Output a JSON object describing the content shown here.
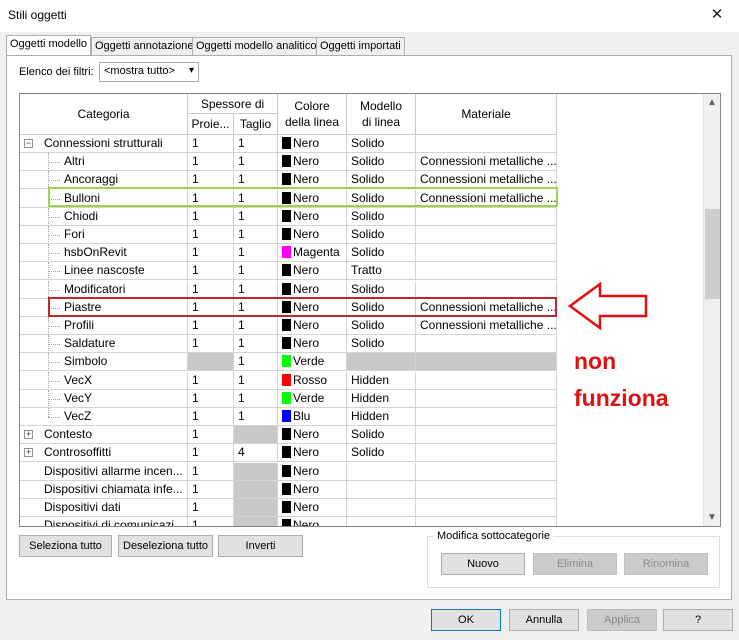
{
  "window": {
    "title": "Stili oggetti",
    "close_glyph": "✕"
  },
  "tabs": [
    "Oggetti modello",
    "Oggetti annotazione",
    "Oggetti modello analitico",
    "Oggetti importati"
  ],
  "filter": {
    "label": "Elenco dei filtri:",
    "value": "<mostra tutto>"
  },
  "columns": {
    "categoria": "Categoria",
    "spessore": "Spessore di",
    "proiezione": "Proie...",
    "taglio": "Taglio",
    "colore": "Colore della linea",
    "modello": "Modello di linea",
    "materiale": "Materiale"
  },
  "colors": {
    "Nero": "#000000",
    "Magenta": "#ff00ff",
    "Verde": "#00ff00",
    "Rosso": "#ff0000",
    "Blu": "#0000ff"
  },
  "rows": [
    {
      "name": "Connessioni strutturali",
      "level": 0,
      "expander": "−",
      "proj": "1",
      "cut": "1",
      "color": "Nero",
      "pattern": "Solido",
      "material": ""
    },
    {
      "name": "Altri",
      "level": 1,
      "proj": "1",
      "cut": "1",
      "color": "Nero",
      "pattern": "Solido",
      "material": "Connessioni metalliche ..."
    },
    {
      "name": "Ancoraggi",
      "level": 1,
      "proj": "1",
      "cut": "1",
      "color": "Nero",
      "pattern": "Solido",
      "material": "Connessioni metalliche ..."
    },
    {
      "name": "Bulloni",
      "level": 1,
      "proj": "1",
      "cut": "1",
      "color": "Nero",
      "pattern": "Solido",
      "material": "Connessioni metalliche ..."
    },
    {
      "name": "Chiodi",
      "level": 1,
      "proj": "1",
      "cut": "1",
      "color": "Nero",
      "pattern": "Solido",
      "material": ""
    },
    {
      "name": "Fori",
      "level": 1,
      "proj": "1",
      "cut": "1",
      "color": "Nero",
      "pattern": "Solido",
      "material": ""
    },
    {
      "name": "hsbOnRevit",
      "level": 1,
      "proj": "1",
      "cut": "1",
      "color": "Magenta",
      "pattern": "Solido",
      "material": ""
    },
    {
      "name": "Linee nascoste",
      "level": 1,
      "proj": "1",
      "cut": "1",
      "color": "Nero",
      "pattern": "Tratto",
      "material": ""
    },
    {
      "name": "Modificatori",
      "level": 1,
      "proj": "1",
      "cut": "1",
      "color": "Nero",
      "pattern": "Solido",
      "material": ""
    },
    {
      "name": "Piastre",
      "level": 1,
      "proj": "1",
      "cut": "1",
      "color": "Nero",
      "pattern": "Solido",
      "material": "Connessioni metalliche ..."
    },
    {
      "name": "Profili",
      "level": 1,
      "proj": "1",
      "cut": "1",
      "color": "Nero",
      "pattern": "Solido",
      "material": "Connessioni metalliche ..."
    },
    {
      "name": "Saldature",
      "level": 1,
      "proj": "1",
      "cut": "1",
      "color": "Nero",
      "pattern": "Solido",
      "material": ""
    },
    {
      "name": "Simbolo",
      "level": 1,
      "proj": "",
      "proj_gray": true,
      "cut": "1",
      "color": "Verde",
      "pattern": "",
      "pattern_gray": true,
      "material": "",
      "material_gray": true
    },
    {
      "name": "VecX",
      "level": 1,
      "proj": "1",
      "cut": "1",
      "color": "Rosso",
      "pattern": "Hidden",
      "material": ""
    },
    {
      "name": "VecY",
      "level": 1,
      "proj": "1",
      "cut": "1",
      "color": "Verde",
      "pattern": "Hidden",
      "material": ""
    },
    {
      "name": "VecZ",
      "level": 1,
      "proj": "1",
      "cut": "1",
      "color": "Blu",
      "pattern": "Hidden",
      "material": ""
    },
    {
      "name": "Contesto",
      "level": 0,
      "expander": "+",
      "proj": "1",
      "cut": "",
      "cut_gray": true,
      "color": "Nero",
      "pattern": "Solido",
      "material": ""
    },
    {
      "name": "Controsoffitti",
      "level": 0,
      "expander": "+",
      "proj": "1",
      "cut": "4",
      "color": "Nero",
      "pattern": "Solido",
      "material": ""
    },
    {
      "name": "Dispositivi allarme incen...",
      "level": 0,
      "proj": "1",
      "cut": "",
      "cut_gray": true,
      "color": "Nero",
      "pattern": "",
      "material": ""
    },
    {
      "name": "Dispositivi chiamata infe...",
      "level": 0,
      "proj": "1",
      "cut": "",
      "cut_gray": true,
      "color": "Nero",
      "pattern": "",
      "material": ""
    },
    {
      "name": "Dispositivi dati",
      "level": 0,
      "proj": "1",
      "cut": "",
      "cut_gray": true,
      "color": "Nero",
      "pattern": "",
      "material": ""
    },
    {
      "name": "Dispositivi di comunicazi...",
      "level": 0,
      "proj": "1",
      "cut": "",
      "cut_gray": true,
      "color": "Nero",
      "pattern": "",
      "material": ""
    }
  ],
  "annotation": {
    "line1": "non",
    "line2": "funziona"
  },
  "buttons": {
    "select_all": "Seleziona tutto",
    "deselect_all": "Deseleziona tutto",
    "invert": "Inverti",
    "group_title": "Modifica sottocategorie",
    "new": "Nuovo",
    "delete": "Elimina",
    "rename": "Rinomina",
    "ok": "OK",
    "cancel": "Annulla",
    "apply": "Applica",
    "help": "?"
  }
}
